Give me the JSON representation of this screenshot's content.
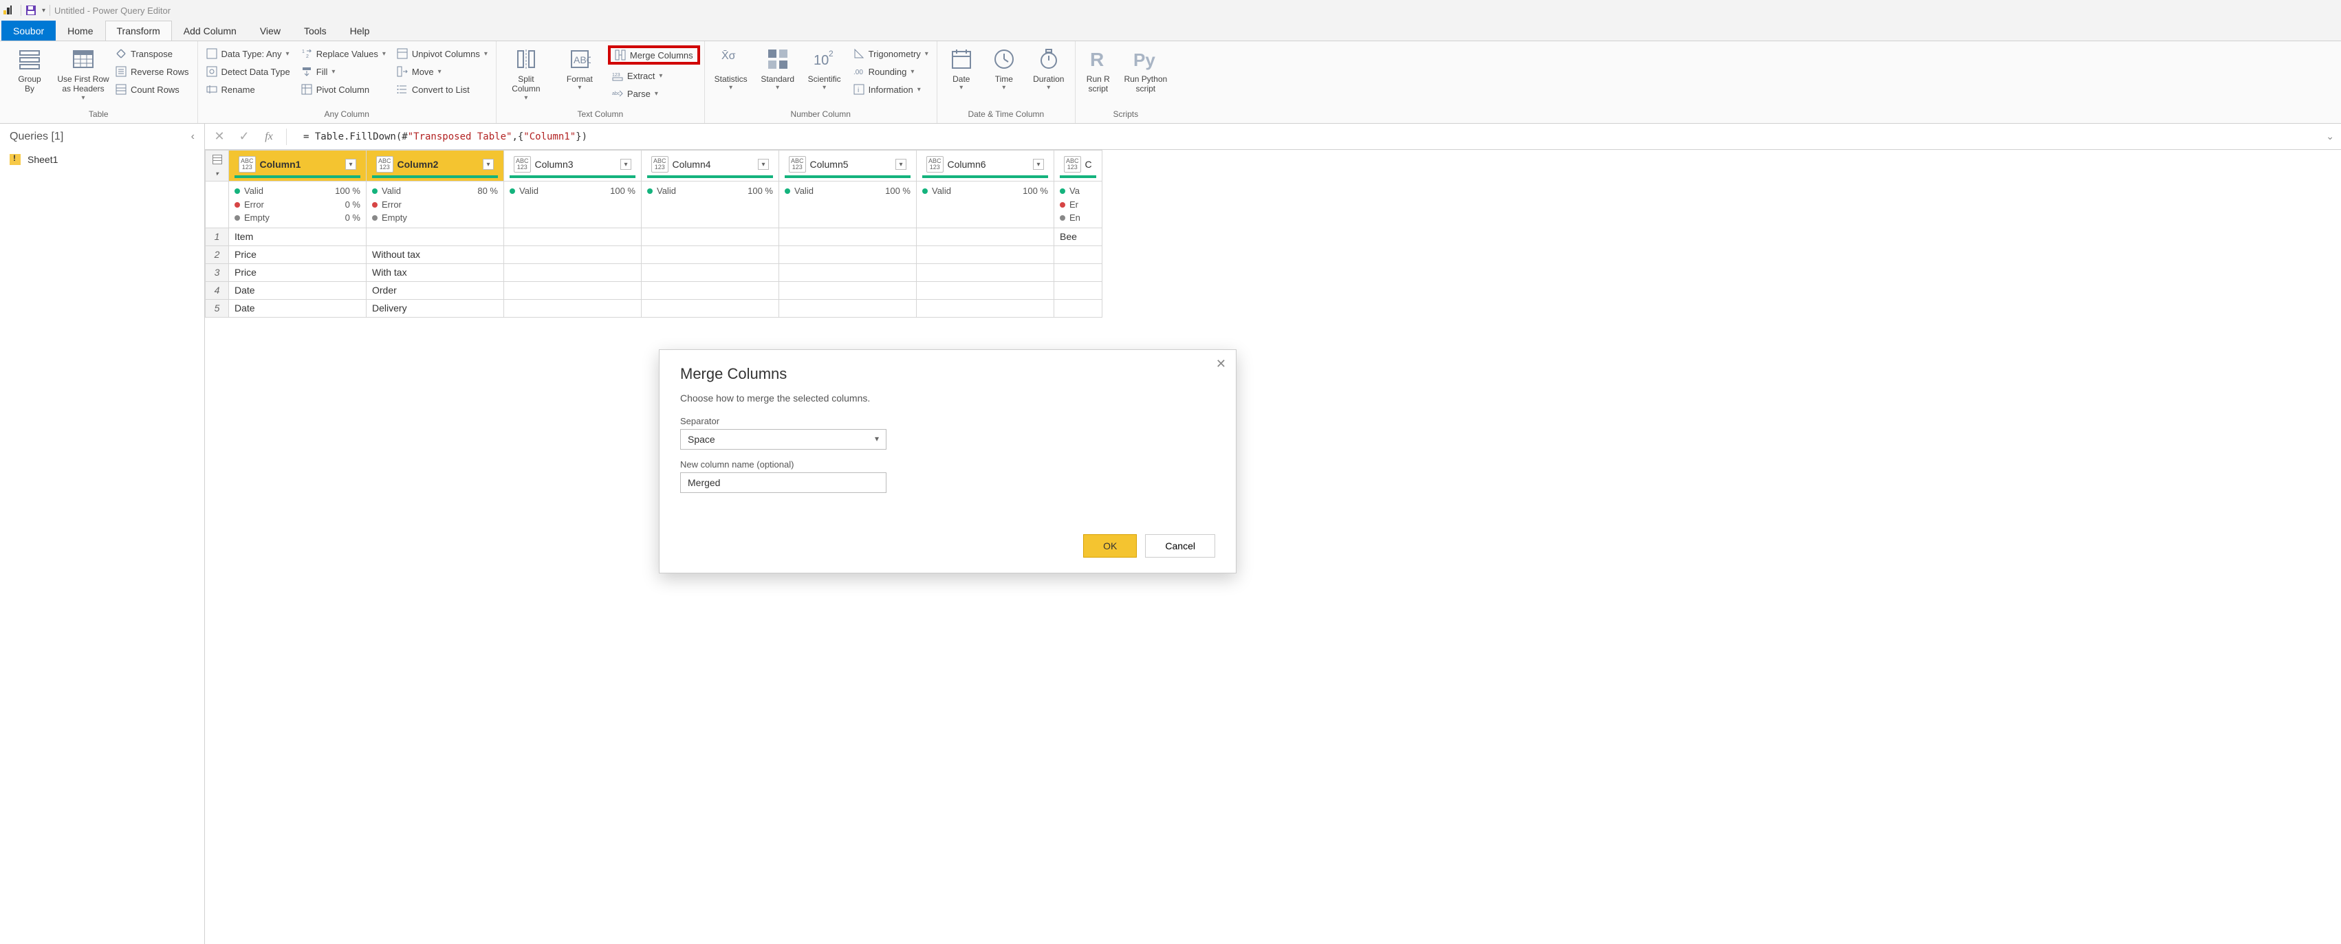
{
  "title": "Untitled - Power Query Editor",
  "menu": {
    "file": "Soubor",
    "tabs": [
      "Home",
      "Transform",
      "Add Column",
      "View",
      "Tools",
      "Help"
    ],
    "active_index": 1
  },
  "ribbon": {
    "groups": {
      "table": {
        "label": "Table",
        "group_by": "Group\nBy",
        "use_headers": "Use First Row\nas Headers",
        "transpose": "Transpose",
        "reverse": "Reverse Rows",
        "count": "Count Rows"
      },
      "any_column": {
        "label": "Any Column",
        "data_type": "Data Type: Any",
        "detect": "Detect Data Type",
        "rename": "Rename",
        "replace": "Replace Values",
        "fill": "Fill",
        "pivot": "Pivot Column",
        "unpivot": "Unpivot Columns",
        "move": "Move",
        "convert_list": "Convert to List"
      },
      "text_column": {
        "label": "Text Column",
        "split": "Split\nColumn",
        "format": "Format",
        "merge": "Merge Columns",
        "extract": "Extract",
        "parse": "Parse"
      },
      "number_column": {
        "label": "Number Column",
        "statistics": "Statistics",
        "standard": "Standard",
        "scientific": "Scientific",
        "trig": "Trigonometry",
        "rounding": "Rounding",
        "info": "Information"
      },
      "datetime": {
        "label": "Date & Time Column",
        "date": "Date",
        "time": "Time",
        "duration": "Duration"
      },
      "scripts": {
        "label": "Scripts",
        "r": "Run R\nscript",
        "py": "Run Python\nscript"
      }
    }
  },
  "queries": {
    "header": "Queries [1]",
    "items": [
      "Sheet1"
    ]
  },
  "formula": {
    "prefix": "= Table.FillDown(#",
    "str1": "\"Transposed Table\"",
    "mid": ",{",
    "str2": "\"Column1\"",
    "suffix": "})"
  },
  "grid": {
    "type_abc": "ABC",
    "type_123": "123",
    "columns": [
      "Column1",
      "Column2",
      "Column3",
      "Column4",
      "Column5",
      "Column6",
      "C"
    ],
    "col7_partial": "C",
    "selected_cols": [
      0,
      1
    ],
    "quality": {
      "valid_label": "Valid",
      "error_label": "Error",
      "empty_label": "Empty",
      "col1": {
        "valid": "100 %",
        "error": "0 %",
        "empty": "0 %"
      },
      "col2": {
        "valid": "80 %",
        "error": "",
        "empty": ""
      },
      "other_valid": "100 %",
      "col7": {
        "valid": "Va",
        "error": "Er",
        "empty": "En"
      }
    },
    "rows": [
      {
        "n": "1",
        "c1": "Item",
        "c2": "",
        "c7": "Bee"
      },
      {
        "n": "2",
        "c1": "Price",
        "c2": "Without tax",
        "c7": ""
      },
      {
        "n": "3",
        "c1": "Price",
        "c2": "With tax",
        "c7": ""
      },
      {
        "n": "4",
        "c1": "Date",
        "c2": "Order",
        "c7": ""
      },
      {
        "n": "5",
        "c1": "Date",
        "c2": "Delivery",
        "c7": ""
      }
    ]
  },
  "dialog": {
    "title": "Merge Columns",
    "subtitle": "Choose how to merge the selected columns.",
    "sep_label": "Separator",
    "sep_value": "Space",
    "name_label": "New column name (optional)",
    "name_value": "Merged",
    "ok": "OK",
    "cancel": "Cancel"
  }
}
